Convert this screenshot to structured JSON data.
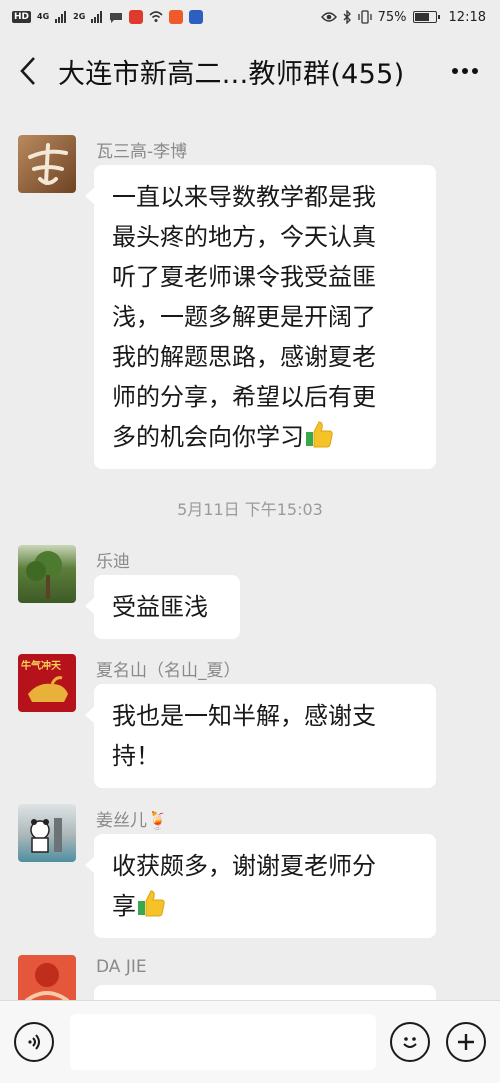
{
  "status_bar": {
    "badge_hd": "HD",
    "signal1": "4G",
    "signal2": "2G",
    "battery": "75%",
    "time": "12:18"
  },
  "header": {
    "back": "<",
    "title": "大连市新高二...教师群(455)",
    "more": "···"
  },
  "messages": [
    {
      "sender": "瓦三高-李博",
      "avatar_icon": "calligraphy-li-avatar",
      "lines": [
        "一直以来导数教学都是我",
        "最头疼的地方，今天认真",
        "听了夏老师课令我受益匪",
        "浅，一题多解更是开阔了",
        "我的解题思路，感谢夏老",
        "师的分享，希望以后有更",
        "多的机会向你学习"
      ],
      "has_thumb": true
    },
    {
      "sender": "乐迪",
      "avatar_icon": "tree-photo-avatar",
      "lines": [
        "受益匪浅"
      ],
      "has_thumb": false
    },
    {
      "sender": "夏名山（名山_夏）",
      "avatar_icon": "golden-bull-avatar",
      "avatar_text": "牛气冲天",
      "lines": [
        "我也是一知半解，感谢支",
        "持！"
      ],
      "has_thumb": false
    },
    {
      "sender": "姜丝儿🍹",
      "avatar_icon": "panda-statue-avatar",
      "lines": [
        "收获颇多，谢谢夏老师分",
        "享"
      ],
      "has_thumb": true
    },
    {
      "sender": "DA  JIE",
      "avatar_icon": "red-sun-avatar",
      "lines": [
        ""
      ],
      "has_thumb": false
    }
  ],
  "timestamp": "5月11日 下午15:03",
  "input_bar": {
    "voice_icon": "voice-icon",
    "emoji_icon": "emoji-icon",
    "plus_icon": "plus-icon"
  },
  "colors": {
    "chat_bg": "#ededed",
    "bubble_bg": "#ffffff",
    "sender_text": "#8a8a8a",
    "thumb_yellow": "#f5c327",
    "thumb_green": "#3aa84a"
  }
}
